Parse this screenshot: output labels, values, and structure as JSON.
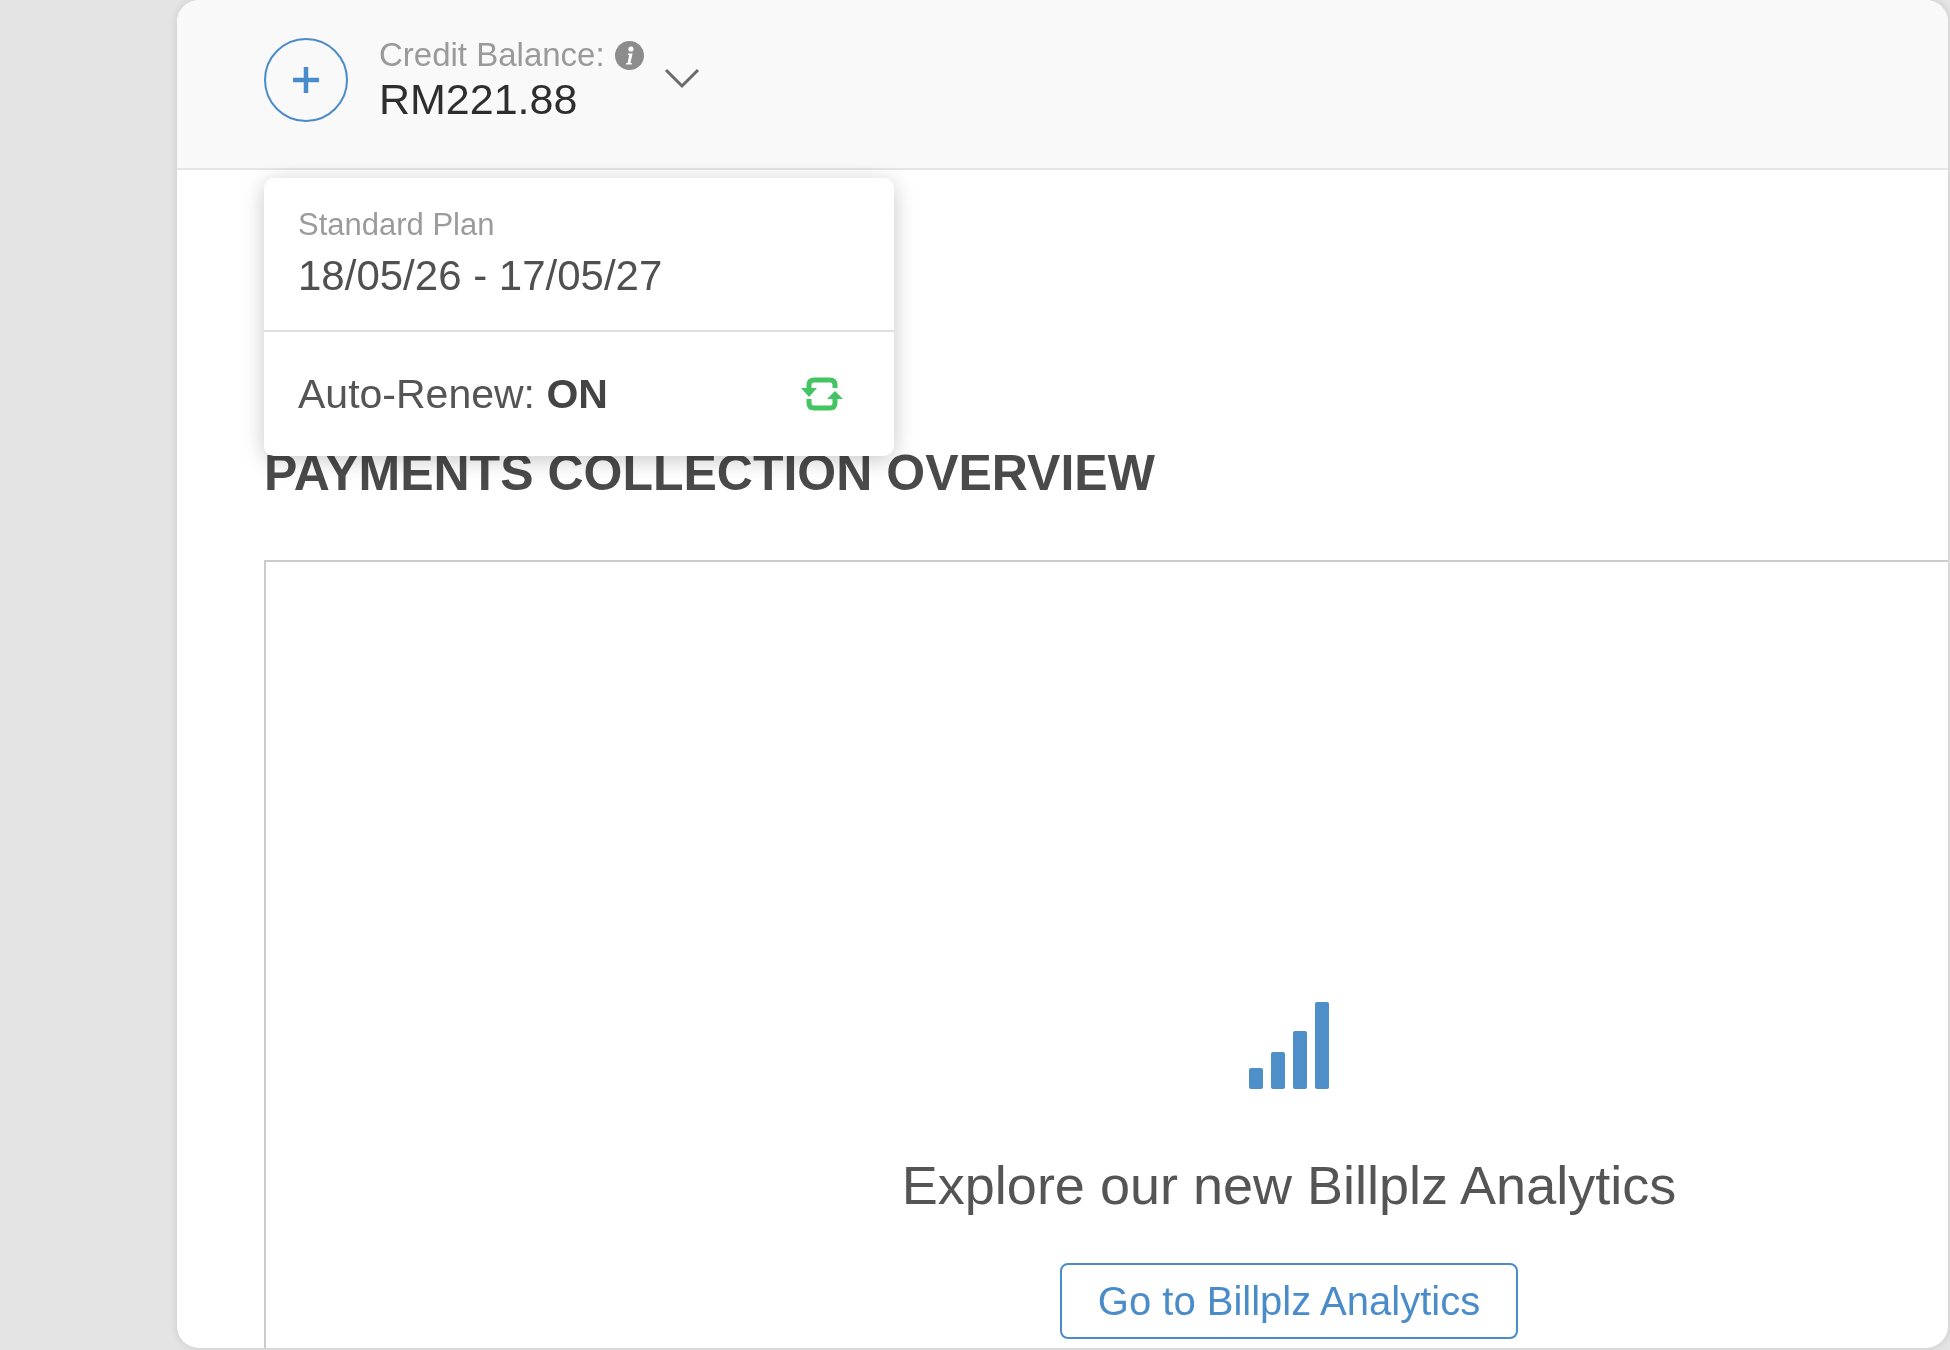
{
  "credit": {
    "label": "Credit Balance:",
    "amount": "RM221.88",
    "expanded": true
  },
  "plan_menu": {
    "plan": "Standard Plan",
    "period": "18/05/26 - 17/05/27",
    "auto_renew": "Auto-Renew: **ON**"
  },
  "section": {
    "title": "PAYMENTS COLLECTION OVERVIEW"
  },
  "analytics_promo": {
    "message": "Explore our new Billplz Analytics",
    "button": "Go to Billplz Analytics"
  }
}
